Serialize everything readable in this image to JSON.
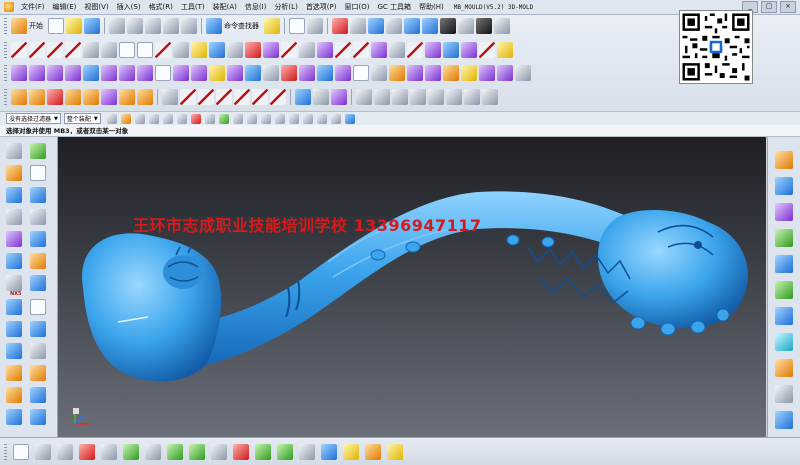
{
  "menubar": {
    "items": [
      "文件(F)",
      "编辑(E)",
      "视图(V)",
      "插入(S)",
      "格式(R)",
      "工具(T)",
      "装配(A)",
      "信息(I)",
      "分析(L)",
      "首选项(P)",
      "窗口(O)",
      "GC 工具箱",
      "帮助(H)"
    ],
    "window_title": "MB_MOULD(V5.2)   3D-MOLD",
    "controls": [
      "_",
      "▢",
      "×"
    ]
  },
  "toolbar": {
    "start_label": "开始",
    "command_finder_label": "命令查找器"
  },
  "filterbar": {
    "filter_value": "没有选择过滤器",
    "assembly_value": "整个装配"
  },
  "cue": {
    "text": "选择对象并使用 MB3，或者双击某一对象"
  },
  "left_resource_bar": {
    "nx_badge": "NX5"
  },
  "viewport": {
    "watermark": "王环市志成职业技能培训学校  13396947117",
    "background_top": "#1d1f24",
    "background_bottom": "#6b6f78",
    "model_color": "#3aa4ec"
  },
  "qr": {
    "label": "QR code"
  }
}
